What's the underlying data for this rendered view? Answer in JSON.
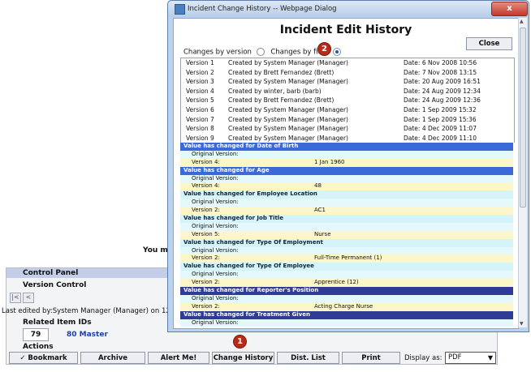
{
  "background": {
    "notice_fragment": "You ma",
    "control_panel": {
      "title": "Control Panel",
      "version_control_title": "Version Control",
      "last_edited": "Last edited by:System Manager (Manager) on 12",
      "related_title": "Related Item IDs",
      "related_id": "79",
      "related_link": "80 Master",
      "actions_title": "Actions",
      "actions": [
        "✓ Bookmark",
        "Archive",
        "Alert Me!",
        "Change History",
        "Dist. List",
        "Print"
      ],
      "display_as_label": "Display as:",
      "display_as_value": "PDF"
    }
  },
  "badges": {
    "one": "1",
    "two": "2"
  },
  "dialog": {
    "window_title": "Incident Change History -- Webpage Dialog",
    "close_x": "x",
    "heading": "Incident Edit History",
    "close_button": "Close",
    "mode_by_version": "Changes by version",
    "mode_by_field": "Changes by field",
    "versions": [
      {
        "version": "Version 1",
        "created": "Created by System Manager (Manager)",
        "date": "Date: 6 Nov 2008 10:56"
      },
      {
        "version": "Version 2",
        "created": "Created by Brett Fernandez (Brett)",
        "date": "Date: 7 Nov 2008 13:15"
      },
      {
        "version": "Version 3",
        "created": "Created by System Manager (Manager)",
        "date": "Date: 20 Aug 2009 16:51"
      },
      {
        "version": "Version 4",
        "created": "Created by winter, barb (barb)",
        "date": "Date: 24 Aug 2009 12:34"
      },
      {
        "version": "Version 5",
        "created": "Created by Brett Fernandez (Brett)",
        "date": "Date: 24 Aug 2009 12:36"
      },
      {
        "version": "Version 6",
        "created": "Created by System Manager (Manager)",
        "date": "Date: 1 Sep 2009 15:32"
      },
      {
        "version": "Version 7",
        "created": "Created by System Manager (Manager)",
        "date": "Date: 1 Sep 2009 15:36"
      },
      {
        "version": "Version 8",
        "created": "Created by System Manager (Manager)",
        "date": "Date: 4 Dec 2009 11:07"
      },
      {
        "version": "Version 9",
        "created": "Created by System Manager (Manager)",
        "date": "Date: 4 Dec 2009 11:10"
      }
    ],
    "changes": [
      {
        "head": "Value has changed for Date of Birth",
        "style": "dark",
        "original": "Original Version:",
        "changed_label": "Version 4:",
        "changed_value": "1 Jan 1960"
      },
      {
        "head": "Value has changed for Age",
        "style": "dark",
        "original": "Original Version:",
        "changed_label": "Version 4:",
        "changed_value": "48"
      },
      {
        "head": "Value has changed for Employee Location",
        "style": "cyan",
        "original": "Original Version:",
        "changed_label": "Version 2:",
        "changed_value": "AC1"
      },
      {
        "head": "Value has changed for Job Title",
        "style": "cyan",
        "original": "Original Version:",
        "changed_label": "Version 5:",
        "changed_value": "Nurse"
      },
      {
        "head": "Value has changed for Type Of Employment",
        "style": "cyan",
        "original": "Original Version:",
        "changed_label": "Version 2:",
        "changed_value": "Full-Time Permanent (1)"
      },
      {
        "head": "Value has changed for Type Of Employee",
        "style": "cyan",
        "original": "Original Version:",
        "changed_label": "Version 2:",
        "changed_value": "Apprentice (12)"
      },
      {
        "head": "Value has changed for Reporter's Position",
        "style": "navy",
        "original": "Original Version:",
        "changed_label": "Version 2:",
        "changed_value": "Acting Charge Nurse"
      },
      {
        "head": "Value has changed for Treatment Given",
        "style": "navy",
        "original": "Original Version:",
        "changed_label": "",
        "changed_value": ""
      }
    ]
  }
}
